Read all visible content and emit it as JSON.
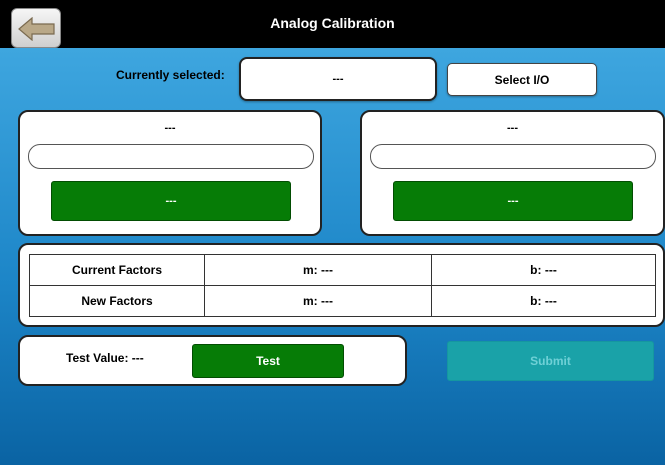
{
  "header": {
    "title": "Analog Calibration",
    "back_icon": "back-arrow-icon"
  },
  "selection": {
    "label": "Currently selected:",
    "value": "---",
    "select_button": "Select I/O"
  },
  "panels": [
    {
      "title": "---",
      "input_value": "",
      "button_label": "---"
    },
    {
      "title": "---",
      "input_value": "",
      "button_label": "---"
    }
  ],
  "factors": {
    "rows": [
      {
        "label": "Current Factors",
        "m": "m: ---",
        "b": "b: ---"
      },
      {
        "label": "New Factors",
        "m": "m: ---",
        "b": "b: ---"
      }
    ]
  },
  "test": {
    "label": "Test Value: ---",
    "button": "Test"
  },
  "submit": {
    "label": "Submit",
    "disabled": true
  },
  "colors": {
    "accent_green": "#067c06",
    "background_blue": "#1d86c8",
    "disabled_teal": "#1aa2a8"
  }
}
